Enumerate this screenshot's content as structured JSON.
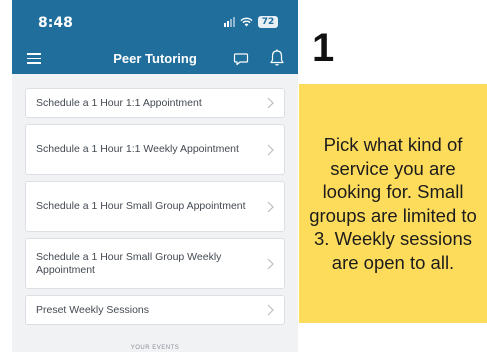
{
  "status_bar": {
    "time": "8:48",
    "battery": "72"
  },
  "header": {
    "title": "Peer Tutoring"
  },
  "services": [
    {
      "label": "Schedule a 1 Hour 1:1 Appointment"
    },
    {
      "label": "Schedule a 1 Hour 1:1 Weekly Appointment"
    },
    {
      "label": "Schedule a 1 Hour Small Group Appointment"
    },
    {
      "label": "Schedule a 1 Hour Small Group Weekly Appointment"
    },
    {
      "label": "Preset Weekly Sessions"
    }
  ],
  "footer_peek": "YOUR EVENTS",
  "annotation": {
    "step": "1",
    "text": "Pick what kind of service you are looking for. Small groups are limited to 3. Weekly sessions are open to all."
  },
  "colors": {
    "header_blue": "#1f6e9c",
    "note_yellow": "#fedc5b",
    "background": "#f1f2f4"
  }
}
